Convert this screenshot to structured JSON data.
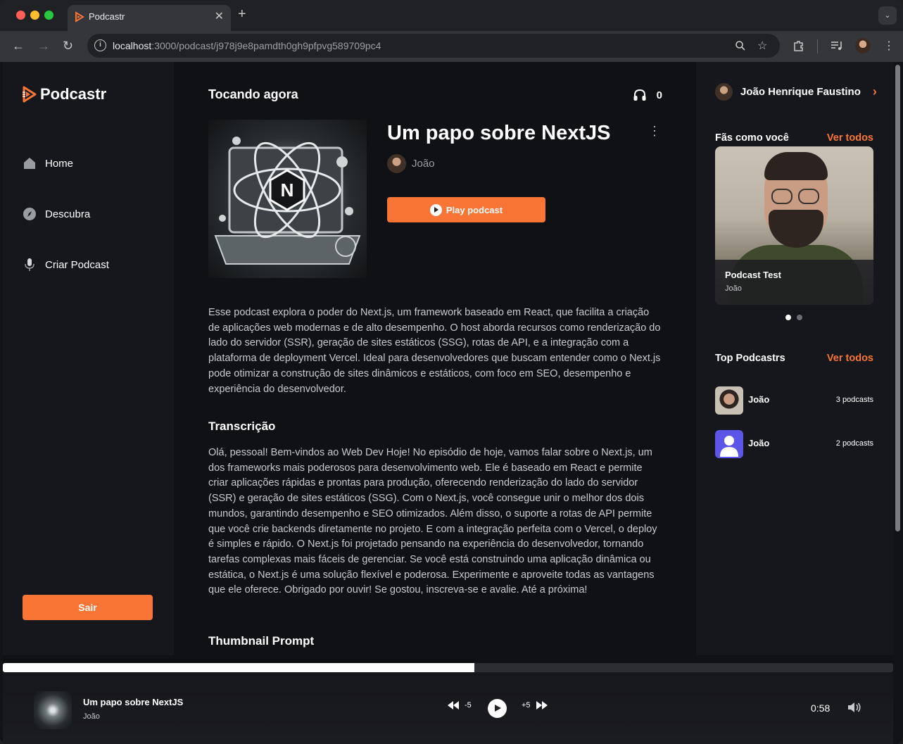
{
  "browser": {
    "tab_title": "Podcastr",
    "url_host": "localhost",
    "url_path": ":3000/podcast/j978j9e8pamdth0gh9pfpvg589709pc4"
  },
  "sidebar": {
    "logo": "Podcastr",
    "items": [
      {
        "label": "Home",
        "icon": "home-icon"
      },
      {
        "label": "Descubra",
        "icon": "compass-icon"
      },
      {
        "label": "Criar Podcast",
        "icon": "microphone-icon"
      }
    ],
    "logout_label": "Sair"
  },
  "main": {
    "section_title": "Tocando agora",
    "listeners": "0",
    "podcast_title": "Um papo sobre NextJS",
    "author": "João",
    "play_label": "Play podcast",
    "description": "Esse podcast explora o poder do Next.js, um framework baseado em React, que facilita a criação de aplicações web modernas e de alto desempenho. O host aborda recursos como renderização do lado do servidor (SSR), geração de sites estáticos (SSG), rotas de API, e a integração com a plataforma de deployment Vercel. Ideal para desenvolvedores que buscam entender como o Next.js pode otimizar a construção de sites dinâmicos e estáticos, com foco em SEO, desempenho e experiência do desenvolvedor.",
    "transcription_heading": "Transcrição",
    "transcription": "Olá, pessoal! Bem-vindos ao Web Dev Hoje! No episódio de hoje, vamos falar sobre o Next.js, um dos frameworks mais poderosos para desenvolvimento web. Ele é baseado em React e permite criar aplicações rápidas e prontas para produção, oferecendo renderização do lado do servidor (SSR) e geração de sites estáticos (SSG). Com o Next.js, você consegue unir o melhor dos dois mundos, garantindo desempenho e SEO otimizados. Além disso, o suporte a rotas de API permite que você crie backends diretamente no projeto. E com a integração perfeita com o Vercel, o deploy é simples e rápido. O Next.js foi projetado pensando na experiência do desenvolvedor, tornando tarefas complexas mais fáceis de gerenciar. Se você está construindo uma aplicação dinâmica ou estática, o Next.js é uma solução flexível e poderosa. Experimente e aproveite todas as vantagens que ele oferece. Obrigado por ouvir! Se gostou, inscreva-se e avalie. Até a próxima!",
    "thumbnail_heading": "Thumbnail Prompt"
  },
  "right_sidebar": {
    "user_name": "João Henrique Faustino",
    "fans_heading": "Fãs como você",
    "fans_link": "Ver todos",
    "fan_card": {
      "title": "Podcast Test",
      "author": "João"
    },
    "carousel_active": 0,
    "top_heading": "Top Podcastrs",
    "top_link": "Ver todos",
    "top_podcasters": [
      {
        "name": "João",
        "count": "3 podcasts"
      },
      {
        "name": "João",
        "count": "2 podcasts"
      }
    ]
  },
  "player": {
    "title": "Um papo sobre NextJS",
    "author": "João",
    "rewind_label": "-5",
    "forward_label": "+5",
    "time": "0:58",
    "progress": 0.53
  },
  "colors": {
    "accent": "#f97535",
    "background": "#101114",
    "sidebar": "#15171c"
  }
}
